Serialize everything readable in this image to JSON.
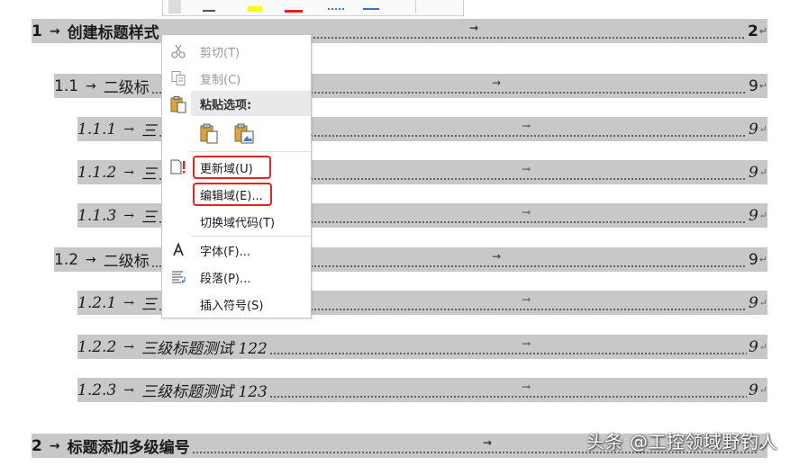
{
  "toc": {
    "entries": [
      {
        "num": "1",
        "title": "创建标题样式",
        "page": "2",
        "level": 1
      },
      {
        "num": "1.1",
        "title": "二级标",
        "page": "9",
        "level": 2
      },
      {
        "num": "1.1.1",
        "title": "三",
        "page": "9",
        "level": 3
      },
      {
        "num": "1.1.2",
        "title": "三",
        "page": "9",
        "level": 3
      },
      {
        "num": "1.1.3",
        "title": "三",
        "page": "9",
        "level": 3
      },
      {
        "num": "1.2",
        "title": "二级标",
        "page": "9",
        "level": 2
      },
      {
        "num": "1.2.1",
        "title": "三",
        "page": "9",
        "level": 3
      },
      {
        "num": "1.2.2",
        "title": "三级标题测试 122",
        "page": "9",
        "level": 3
      },
      {
        "num": "1.2.3",
        "title": "三级标题测试 123",
        "page": "9",
        "level": 3
      },
      {
        "num": "2",
        "title": "标题添加多级编号",
        "page": "",
        "level": 1
      }
    ],
    "arrow": "→",
    "para_mark": "↵"
  },
  "context_menu": {
    "items": {
      "cut": {
        "label": "剪切(T)",
        "icon": "scissors-icon",
        "enabled": false
      },
      "copy": {
        "label": "复制(C)",
        "icon": "copy-icon",
        "enabled": false
      },
      "paste_header": {
        "label": "粘贴选项:",
        "icon": "paste-icon"
      },
      "paste_options": [
        "paste-keep-text-icon",
        "paste-picture-icon"
      ],
      "update_field": {
        "label": "更新域(U)",
        "icon": "update-field-icon",
        "highlighted": true
      },
      "edit_field": {
        "label": "编辑域(E)...",
        "highlighted": true
      },
      "toggle_field_codes": {
        "label": "切换域代码(T)"
      },
      "font": {
        "label": "字体(F)...",
        "icon": "font-icon"
      },
      "paragraph": {
        "label": "段落(P)...",
        "icon": "paragraph-icon"
      },
      "insert_symbol": {
        "label": "插入符号(S)"
      }
    }
  },
  "colors": {
    "toc_highlight": "#c8c8c8",
    "annotation_red": "#e3241c",
    "paste_header_bg": "#e9e9e9"
  },
  "watermark": "头条 @工控领域野钓人"
}
